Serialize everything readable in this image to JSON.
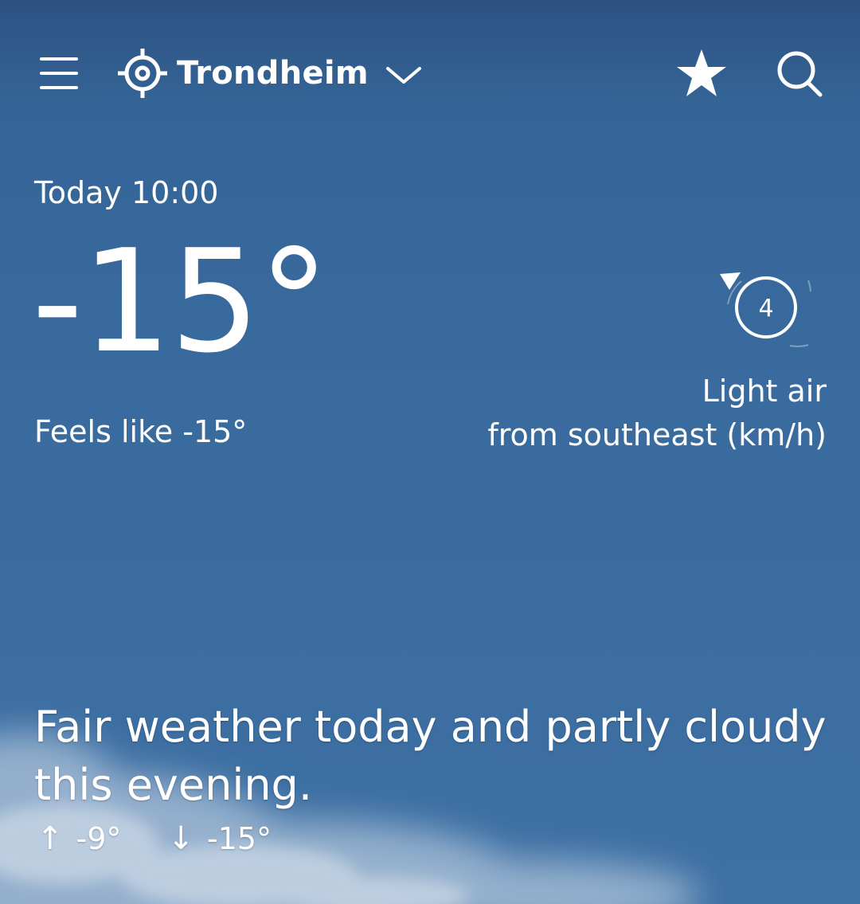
{
  "header": {
    "menu_icon": "hamburger-menu-icon",
    "location_icon": "crosshair-location-icon",
    "location": "Trondheim",
    "dropdown_icon": "chevron-down-icon",
    "favorite_icon": "star-icon",
    "search_icon": "search-icon"
  },
  "current": {
    "time_label": "Today 10:00",
    "temperature": "-15°",
    "feels_like": "Feels like -15°"
  },
  "wind": {
    "speed": "4",
    "description_line1": "Light air",
    "description_line2": "from southeast (km/h)",
    "icon": "wind-direction-icon"
  },
  "forecast": {
    "summary": "Fair weather today and partly cloudy this evening.",
    "high_arrow": "↑",
    "high": "-9°",
    "low_arrow": "↓",
    "low": "-15°"
  },
  "colors": {
    "background_top": "#2c5282",
    "background": "#3a6b9f",
    "text": "#ffffff"
  }
}
